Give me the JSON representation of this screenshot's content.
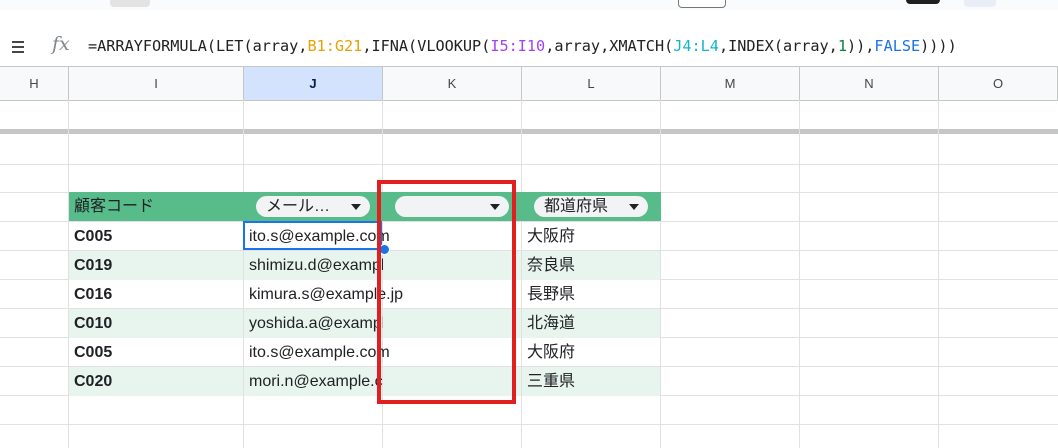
{
  "formula_bar": {
    "fx_label": "fx",
    "tokens": [
      {
        "text": "=ARRAYFORMULA(LET(array,",
        "color": "black"
      },
      {
        "text": "B1:G21",
        "color": "orange"
      },
      {
        "text": ",IFNA(VLOOKUP(",
        "color": "black"
      },
      {
        "text": "I5:I10",
        "color": "purple"
      },
      {
        "text": ",array,XMATCH(",
        "color": "black"
      },
      {
        "text": "J4:L4",
        "color": "teal"
      },
      {
        "text": ",INDEX(array,",
        "color": "black"
      },
      {
        "text": "1",
        "color": "num"
      },
      {
        "text": ")),",
        "color": "black"
      },
      {
        "text": "FALSE",
        "color": "blue"
      },
      {
        "text": "))))",
        "color": "black"
      }
    ]
  },
  "columns": [
    "H",
    "I",
    "J",
    "K",
    "L",
    "M",
    "N",
    "O"
  ],
  "selected_column": "J",
  "table": {
    "header_i": "顧客コード",
    "header_j": "メール…",
    "header_k": "",
    "header_l": "都道府県",
    "rows": [
      {
        "code": "C005",
        "email": "ito.s@example.com",
        "k": "",
        "pref": "大阪府"
      },
      {
        "code": "C019",
        "email": "shimizu.d@example.jp",
        "k": "",
        "pref": "奈良県"
      },
      {
        "code": "C016",
        "email": "kimura.s@example.jp",
        "k": "",
        "pref": "長野県"
      },
      {
        "code": "C010",
        "email": "yoshida.a@example.jp",
        "k": "",
        "pref": "北海道"
      },
      {
        "code": "C005",
        "email": "ito.s@example.com",
        "k": "",
        "pref": "大阪府"
      },
      {
        "code": "C020",
        "email": "mori.n@example.com",
        "k": "",
        "pref": "三重県"
      }
    ]
  },
  "colors": {
    "header_green": "#57bb8a",
    "band_green": "#e8f5ee",
    "highlight_red": "#e02020",
    "selection_blue": "#1a73e8"
  }
}
